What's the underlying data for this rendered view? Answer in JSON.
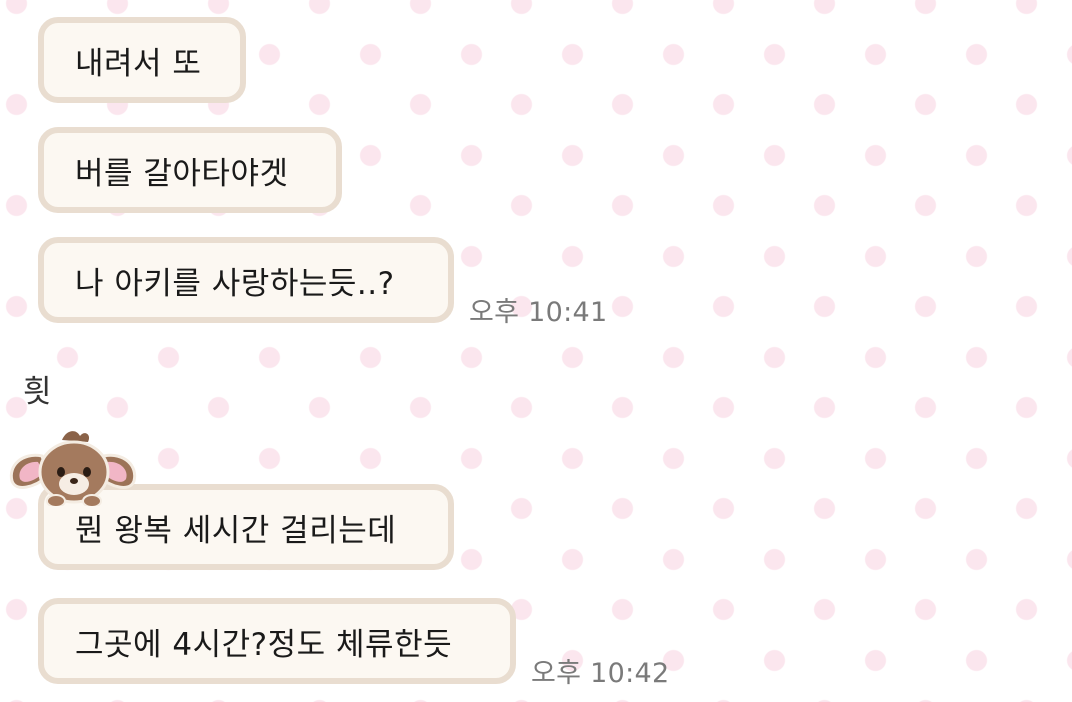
{
  "chat": {
    "group1": {
      "messages": [
        {
          "text": "내려서 또"
        },
        {
          "text": "버를 갈아타야겟"
        },
        {
          "text": "나 아키를 사랑하는듯..?"
        }
      ],
      "time": "오후 10:41"
    },
    "group2": {
      "sender": "흿",
      "avatar_icon": "bunny-plush-icon",
      "messages": [
        {
          "text": "뭔 왕복 세시간 걸리는데"
        },
        {
          "text": "그곳에 4시간?정도 체류한듯"
        }
      ],
      "time": "오후 10:42"
    }
  }
}
